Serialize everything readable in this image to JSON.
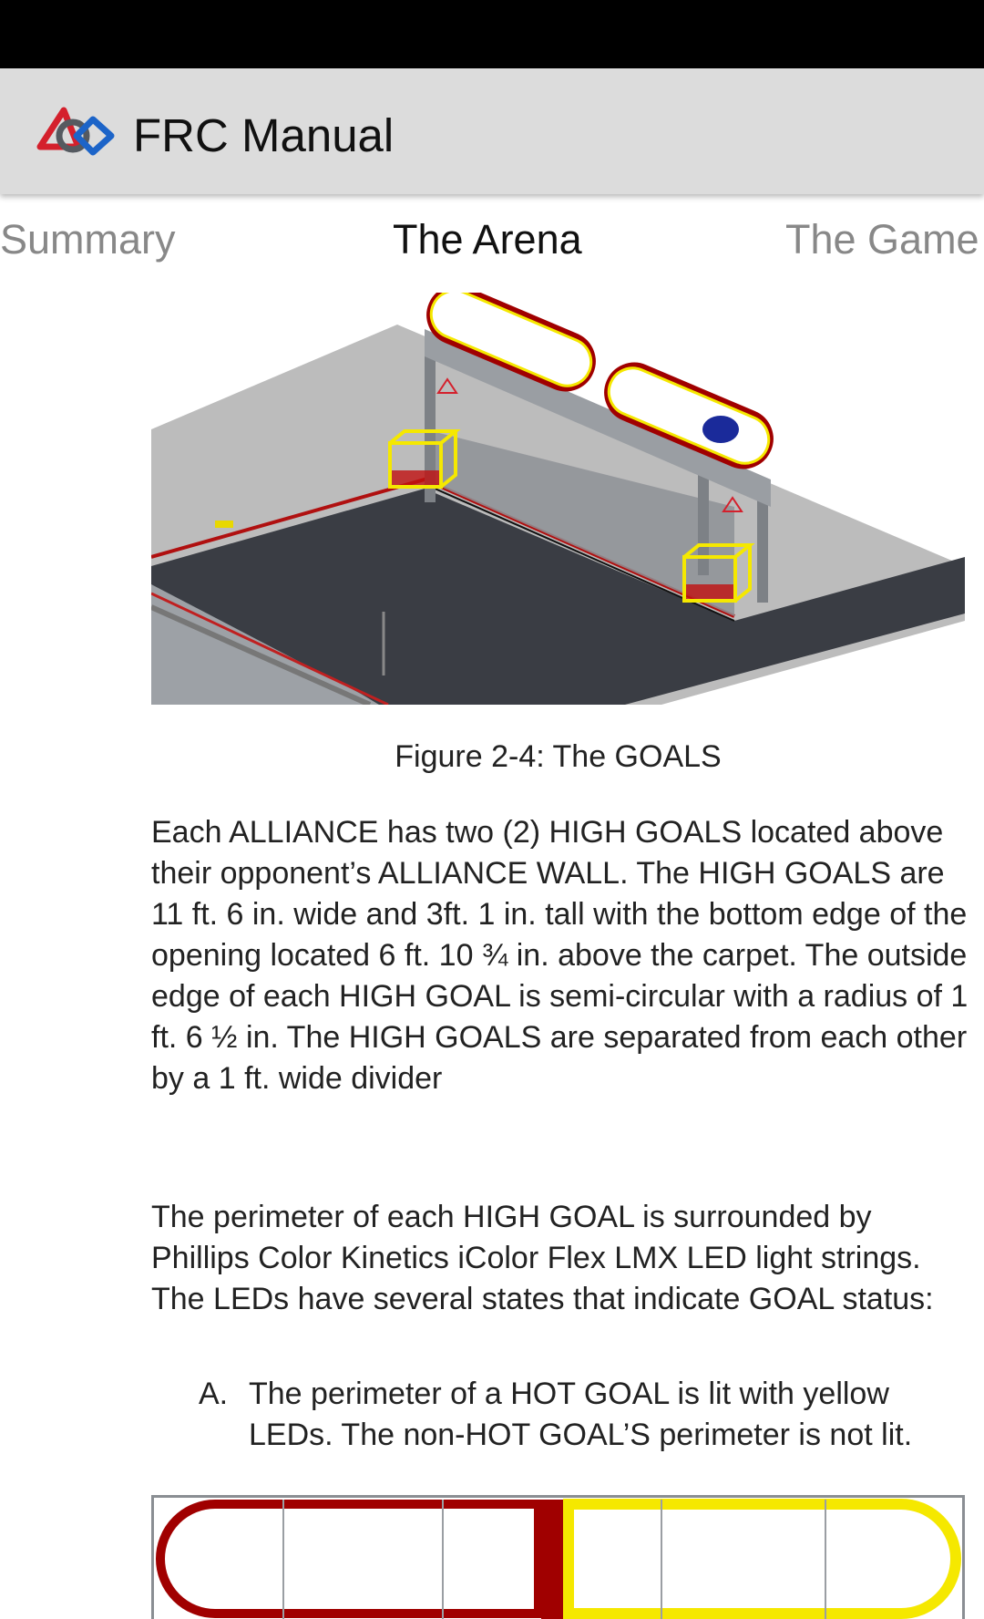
{
  "app": {
    "title": "FRC Manual",
    "logo_icon": "first-logo-icon"
  },
  "tabs": [
    {
      "label": "Summary",
      "active": false
    },
    {
      "label": "The Arena",
      "active": true
    },
    {
      "label": "The Game",
      "active": false
    }
  ],
  "figure": {
    "caption": "Figure 2-4: The GOALS"
  },
  "paragraphs": [
    "Each ALLIANCE has two (2) HIGH GOALS located above their opponent’s ALLIANCE WALL. The HIGH GOALS are 11 ft. 6 in. wide and 3ft. 1 in. tall with the bottom edge of the opening located 6 ft. 10 ¾ in. above the carpet. The outside edge of each HIGH GOAL is semi-circular with a radius of 1 ft. 6 ½ in. The HIGH GOALS are separated from each other by a 1 ft. wide divider",
    "The perimeter of each HIGH GOAL is surrounded by Phillips Color Kinetics iColor Flex LMX LED light strings. The LEDs have several states that indicate GOAL status:"
  ],
  "list": [
    {
      "marker": "A.",
      "text": "The perimeter of a HOT GOAL is lit with yellow LEDs. The non-HOT GOAL’S perimeter is not lit."
    }
  ],
  "colors": {
    "status_bar": "#000000",
    "action_bar": "#dcdcdc",
    "goal_red": "#a00000",
    "goal_yellow": "#f5e800",
    "carpet": "#3a3d44"
  }
}
